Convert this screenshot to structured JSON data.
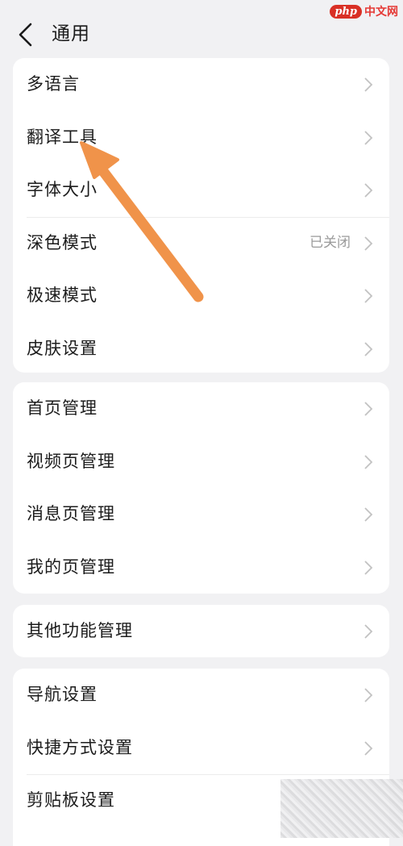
{
  "header": {
    "title": "通用"
  },
  "watermark": {
    "badge": "php",
    "text": "中文网"
  },
  "groups": [
    {
      "items": [
        {
          "label": "多语言"
        },
        {
          "label": "翻译工具"
        },
        {
          "label": "字体大小"
        },
        {
          "label": "深色模式",
          "value": "已关闭"
        },
        {
          "label": "极速模式"
        },
        {
          "label": "皮肤设置"
        }
      ]
    },
    {
      "items": [
        {
          "label": "首页管理"
        },
        {
          "label": "视频页管理"
        },
        {
          "label": "消息页管理"
        },
        {
          "label": "我的页管理"
        }
      ]
    },
    {
      "items": [
        {
          "label": "其他功能管理"
        }
      ]
    },
    {
      "items": [
        {
          "label": "导航设置"
        },
        {
          "label": "快捷方式设置"
        },
        {
          "label": "剪贴板设置"
        }
      ]
    }
  ],
  "annotation": {
    "arrow_color": "#f0934a"
  }
}
